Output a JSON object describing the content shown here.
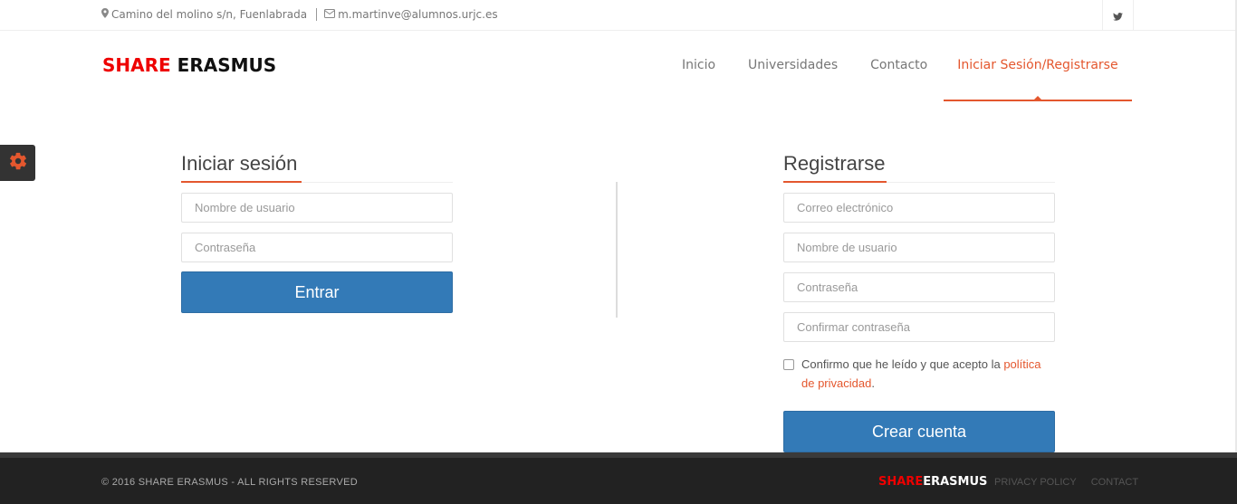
{
  "topbar": {
    "address": "Camino del molino s/n, Fuenlabrada",
    "email": "m.martinve@alumnos.urjc.es"
  },
  "brand": {
    "part1": "SHARE",
    "part2": "ERASMUS"
  },
  "nav": {
    "items": [
      "Inicio",
      "Universidades",
      "Contacto",
      "Iniciar Sesión/Registrarse"
    ],
    "active_index": 3
  },
  "login": {
    "title": "Iniciar sesión",
    "username_placeholder": "Nombre de usuario",
    "password_placeholder": "Contraseña",
    "submit": "Entrar"
  },
  "register": {
    "title": "Registrarse",
    "email_placeholder": "Correo electrónico",
    "username_placeholder": "Nombre de usuario",
    "password_placeholder": "Contraseña",
    "confirm_placeholder": "Confirmar contraseña",
    "terms_text": "Confirmo que he leído y que acepto la ",
    "terms_link": "política de privacidad",
    "terms_end": ".",
    "submit": "Crear cuenta"
  },
  "footer": {
    "copyright": "© 2016 SHARE ERASMUS - ALL RIGHTS RESERVED",
    "logo_part1": "SHARE",
    "logo_part2": "ERASMUS",
    "links": [
      "PRIVACY POLICY",
      "CONTACT"
    ]
  },
  "colors": {
    "accent": "#e4572e",
    "brand_red": "#ee0000",
    "primary_button": "#337ab7"
  }
}
